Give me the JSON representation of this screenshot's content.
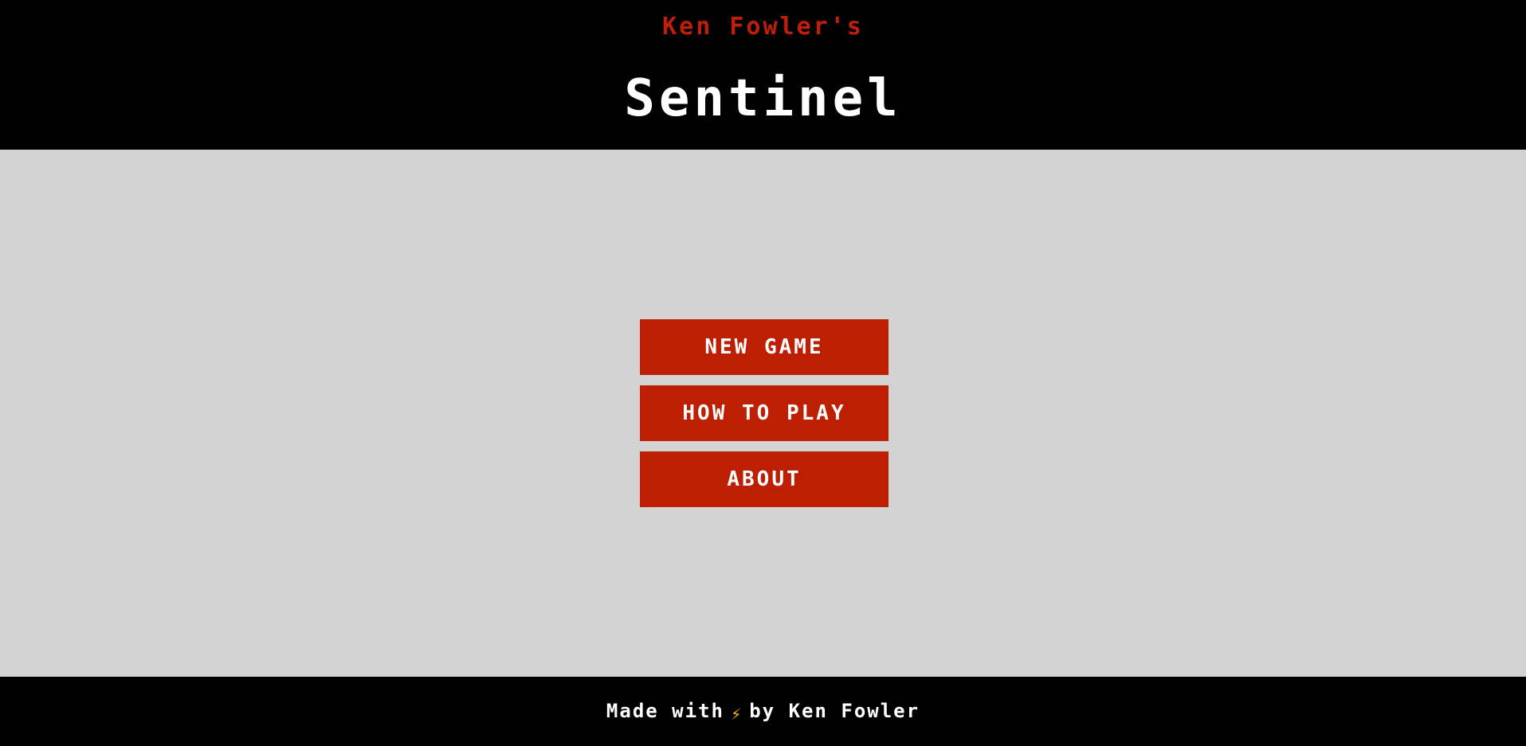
{
  "header": {
    "subtitle": "Ken Fowler's",
    "title": "Sentinel"
  },
  "menu": {
    "new_game": "NEW GAME",
    "how_to_play": "HOW TO PLAY",
    "about": "ABOUT"
  },
  "footer": {
    "made_with": "Made with",
    "icon": "lightning-bolt-icon",
    "bolt_glyph": "⚡",
    "by": "by Ken Fowler"
  },
  "colors": {
    "header_bg": "#000000",
    "accent_red": "#be1e02",
    "main_bg": "#d3d3d3",
    "bolt": "#f5b400"
  }
}
